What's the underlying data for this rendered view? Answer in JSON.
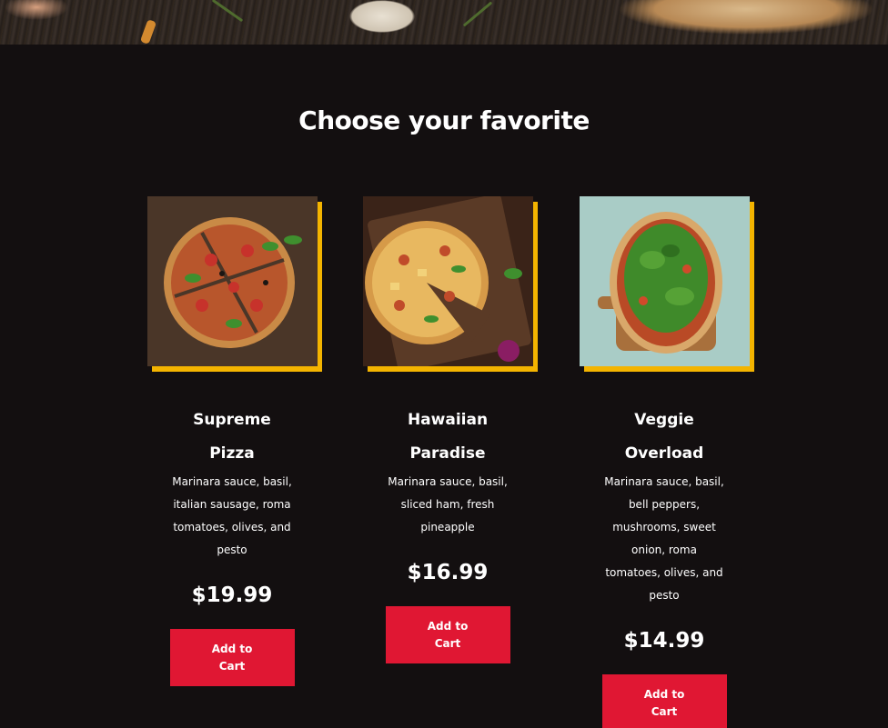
{
  "section": {
    "title": "Choose your favorite"
  },
  "products": [
    {
      "name": "Supreme Pizza",
      "description": "Marinara sauce, basil, italian sausage, roma tomatoes, olives, and pesto",
      "price": "$19.99",
      "button_label": "Add to Cart"
    },
    {
      "name": "Hawaiian Paradise",
      "description": "Marinara sauce, basil, sliced ham, fresh pineapple",
      "price": "$16.99",
      "button_label": "Add to Cart"
    },
    {
      "name": "Veggie Overload",
      "description": "Marinara sauce, basil, bell peppers, mushrooms, sweet onion, roma tomatoes, olives, and pesto",
      "price": "$14.99",
      "button_label": "Add to Cart"
    }
  ],
  "colors": {
    "background": "#130f10",
    "accent_frame": "#f4b400",
    "button": "#e01733"
  }
}
